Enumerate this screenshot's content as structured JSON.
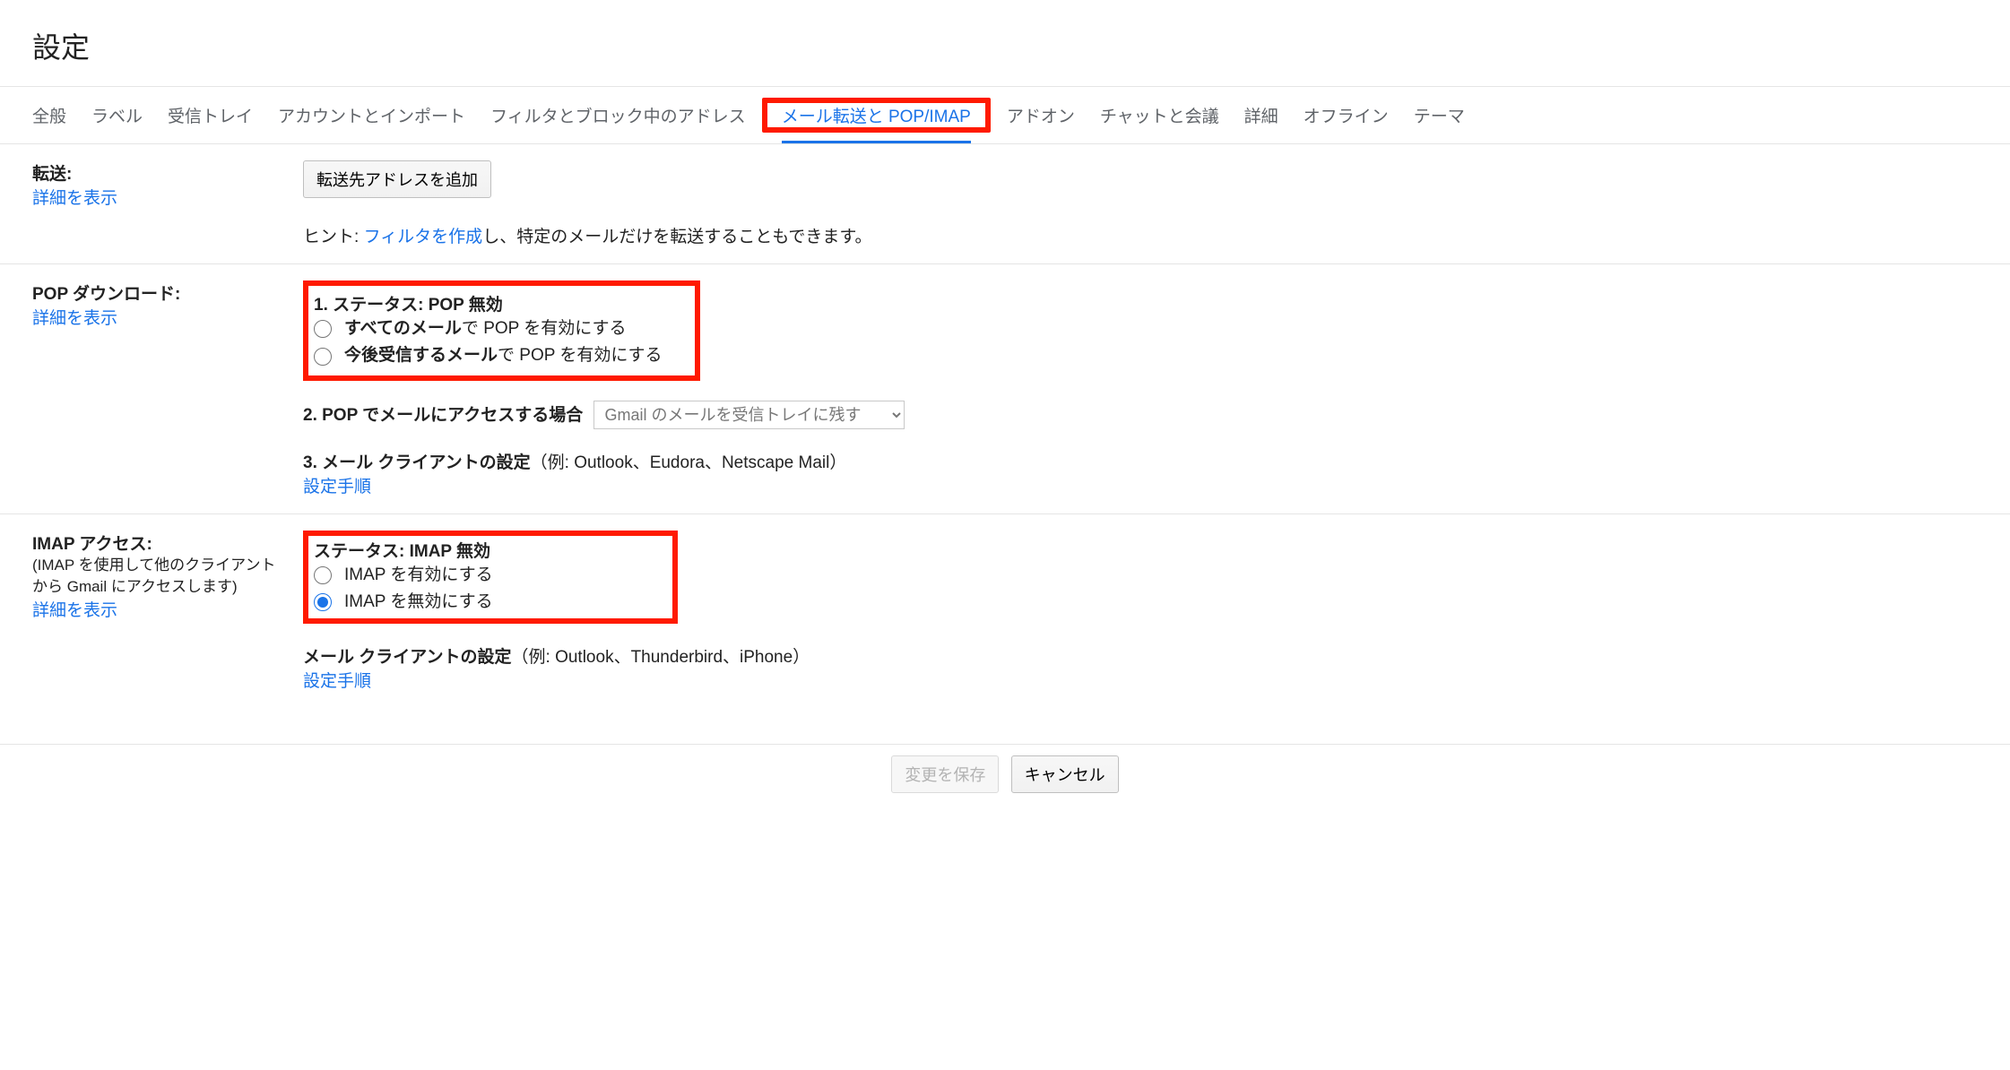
{
  "page_title": "設定",
  "tabs": [
    "全般",
    "ラベル",
    "受信トレイ",
    "アカウントとインポート",
    "フィルタとブロック中のアドレス",
    "メール転送と POP/IMAP",
    "アドオン",
    "チャットと会議",
    "詳細",
    "オフライン",
    "テーマ"
  ],
  "active_tab_index": 5,
  "forwarding": {
    "label": "転送:",
    "learn_more": "詳細を表示",
    "add_btn": "転送先アドレスを追加",
    "hint_prefix": "ヒント: ",
    "hint_link": "フィルタを作成",
    "hint_suffix": "し、特定のメールだけを転送することもできます。"
  },
  "pop": {
    "label": "POP ダウンロード:",
    "learn_more": "詳細を表示",
    "status_prefix": "1. ステータス: ",
    "status_value": "POP 無効",
    "radio1_bold": "すべてのメール",
    "radio1_tail": "で POP を有効にする",
    "radio2_bold": "今後受信するメール",
    "radio2_tail": "で POP を有効にする",
    "step2_bold": "2. POP でメールにアクセスする場合",
    "select_value": "Gmail のメールを受信トレイに残す",
    "step3_bold": "3. メール クライアントの設定",
    "step3_tail": "（例: Outlook、Eudora、Netscape Mail）",
    "steps_link": "設定手順"
  },
  "imap": {
    "label": "IMAP アクセス:",
    "sub": "(IMAP を使用して他のクライアントから Gmail にアクセスします)",
    "learn_more": "詳細を表示",
    "status_prefix": "ステータス: ",
    "status_value": "IMAP 無効",
    "radio_enable": "IMAP を有効にする",
    "radio_disable": "IMAP を無効にする",
    "client_bold": "メール クライアントの設定",
    "client_tail": "（例: Outlook、Thunderbird、iPhone）",
    "steps_link": "設定手順"
  },
  "footer": {
    "save": "変更を保存",
    "cancel": "キャンセル"
  }
}
